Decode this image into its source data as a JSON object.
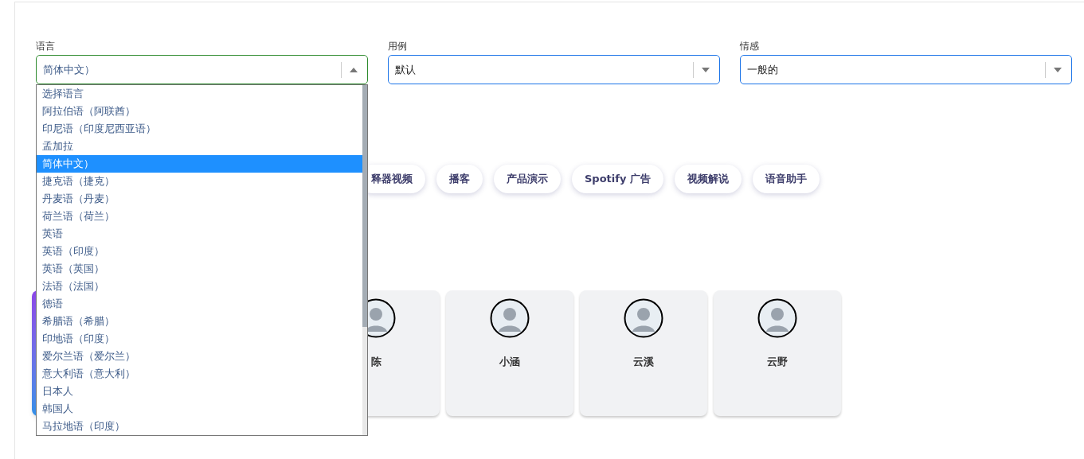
{
  "fields": [
    {
      "label": "语言",
      "value": "简体中文）",
      "open": true
    },
    {
      "label": "用例",
      "value": "默认",
      "open": false
    },
    {
      "label": "情感",
      "value": "一般的",
      "open": false
    }
  ],
  "language_options": [
    {
      "label": "选择语言",
      "selected": false
    },
    {
      "label": "阿拉伯语（阿联酋）",
      "selected": false
    },
    {
      "label": "印尼语（印度尼西亚语）",
      "selected": false
    },
    {
      "label": "孟加拉",
      "selected": false
    },
    {
      "label": "简体中文）",
      "selected": true
    },
    {
      "label": "捷克语（捷克）",
      "selected": false
    },
    {
      "label": "丹麦语（丹麦）",
      "selected": false
    },
    {
      "label": "荷兰语（荷兰）",
      "selected": false
    },
    {
      "label": "英语",
      "selected": false
    },
    {
      "label": "英语（印度）",
      "selected": false
    },
    {
      "label": "英语（英国）",
      "selected": false
    },
    {
      "label": "法语（法国）",
      "selected": false
    },
    {
      "label": "德语",
      "selected": false
    },
    {
      "label": "希腊语（希腊）",
      "selected": false
    },
    {
      "label": "印地语（印度）",
      "selected": false
    },
    {
      "label": "爱尔兰语（爱尔兰）",
      "selected": false
    },
    {
      "label": "意大利语（意大利）",
      "selected": false
    },
    {
      "label": "日本人",
      "selected": false
    },
    {
      "label": "韩国人",
      "selected": false
    },
    {
      "label": "马拉地语（印度）",
      "selected": false
    }
  ],
  "use_case_chips": [
    "释器视频",
    "播客",
    "产品演示",
    "Spotify 广告",
    "视频解说",
    "语音助手"
  ],
  "voices": [
    {
      "selected": true
    },
    {
      "name": "陈",
      "selected": false
    },
    {
      "name": "小涵",
      "selected": false
    },
    {
      "name": "云溪",
      "selected": false
    },
    {
      "name": "云野",
      "selected": false
    }
  ]
}
